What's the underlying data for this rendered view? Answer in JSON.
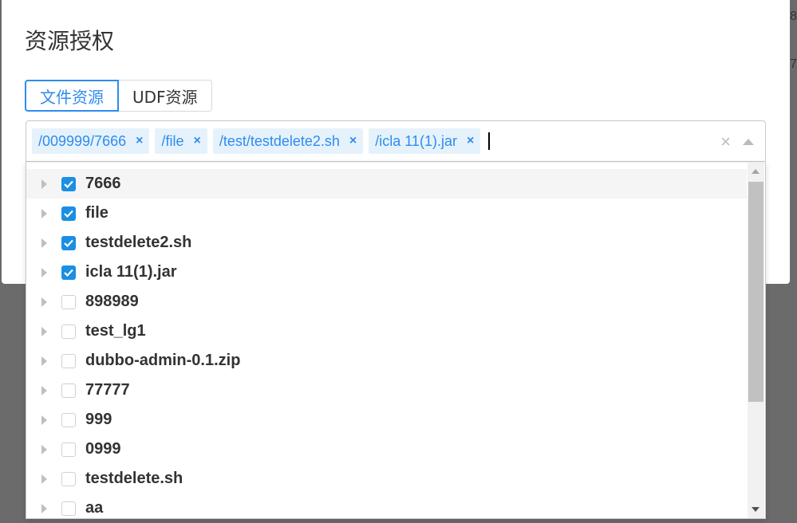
{
  "background": {
    "edge_text_1": "8",
    "edge_text_2": "7"
  },
  "modal": {
    "title": "资源授权",
    "tabs": [
      {
        "label": "文件资源",
        "active": true
      },
      {
        "label": "UDF资源",
        "active": false
      }
    ]
  },
  "select": {
    "tags": [
      {
        "label": "/009999/7666"
      },
      {
        "label": "/file"
      },
      {
        "label": "/test/testdelete2.sh"
      },
      {
        "label": "/icla 11(1).jar"
      }
    ],
    "clear_icon": "close-icon",
    "tag_close_glyph": "×",
    "clear_glyph": "×"
  },
  "tree": {
    "items": [
      {
        "label": "7666",
        "checked": true
      },
      {
        "label": "file",
        "checked": true
      },
      {
        "label": "testdelete2.sh",
        "checked": true
      },
      {
        "label": "icla 11(1).jar",
        "checked": true
      },
      {
        "label": "898989",
        "checked": false
      },
      {
        "label": "test_lg1",
        "checked": false
      },
      {
        "label": "dubbo-admin-0.1.zip",
        "checked": false
      },
      {
        "label": "77777",
        "checked": false
      },
      {
        "label": "999",
        "checked": false
      },
      {
        "label": "0999",
        "checked": false
      },
      {
        "label": "testdelete.sh",
        "checked": false
      },
      {
        "label": "aa",
        "checked": false
      }
    ]
  },
  "colors": {
    "accent": "#2d8cf0",
    "checkbox_checked": "#1a8fe3",
    "tag_bg": "#e6f2fb"
  }
}
